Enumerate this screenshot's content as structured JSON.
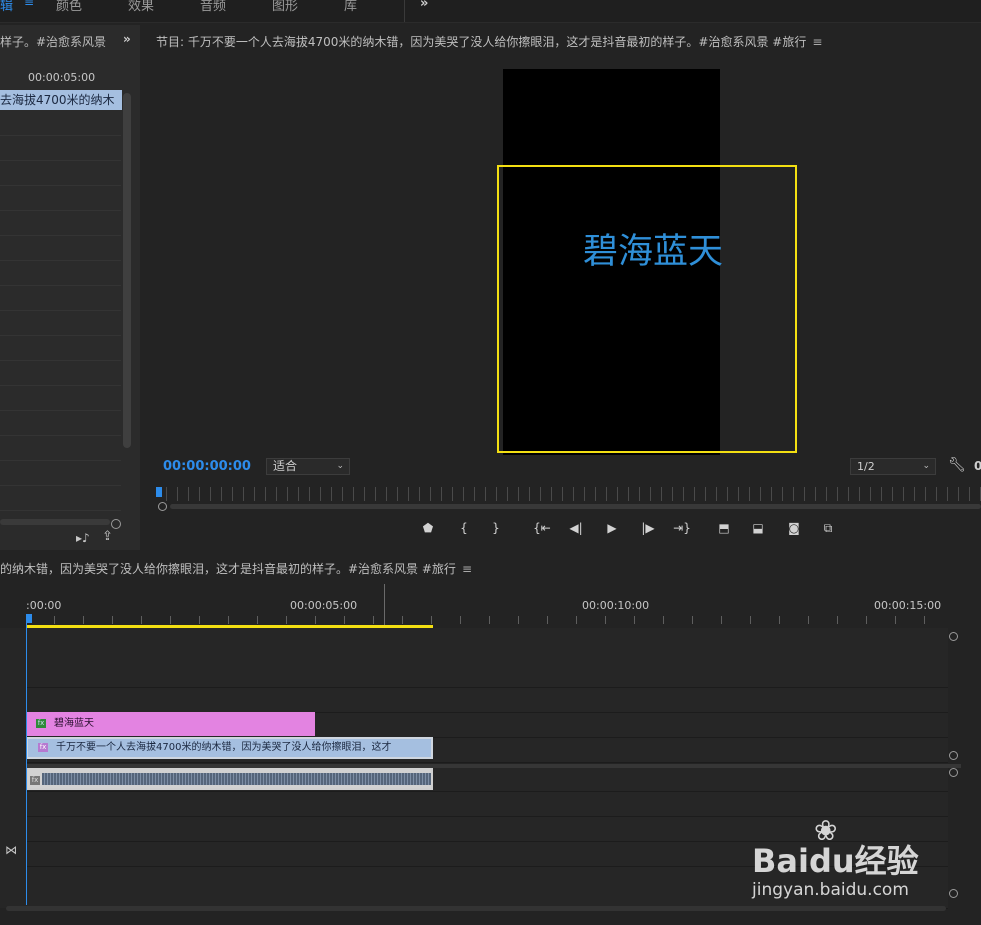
{
  "workspace_tabs": [
    {
      "label": "辑",
      "active": true
    },
    {
      "label": "颜色",
      "active": false
    },
    {
      "label": "效果",
      "active": false
    },
    {
      "label": "音频",
      "active": false
    },
    {
      "label": "图形",
      "active": false
    },
    {
      "label": "库",
      "active": false
    }
  ],
  "workspace_more": "»",
  "source": {
    "title": "样子。#治愈系风景",
    "more": "»",
    "ruler_timecode": "00:00:05:00",
    "clip_label": "去海拔4700米的纳木"
  },
  "program": {
    "title": "节目: 千万不要一个人去海拔4700米的纳木错，因为美哭了没人给你擦眼泪，这才是抖音最初的样子。#治愈系风景 #旅行",
    "menu_icon": "≡",
    "video_text": "碧海蓝天",
    "timecode": "00:00:00:00",
    "fit": "适合",
    "resolution": "1/2",
    "right_edge_text": "0",
    "transport_icons": [
      "marker-icon",
      "mark-in-icon",
      "mark-out-icon",
      "go-to-in-icon",
      "step-back-icon",
      "play-icon",
      "step-forward-icon",
      "go-to-out-icon",
      "lift-icon",
      "extract-icon",
      "export-frame-icon",
      "compare-icon"
    ]
  },
  "timeline": {
    "title": "的纳木错，因为美哭了没人给你擦眼泪，这才是抖音最初的样子。#治愈系风景 #旅行",
    "menu_icon": "≡",
    "ruler": [
      ":00:00",
      "00:00:05:00",
      "00:00:10:00",
      "00:00:15:00"
    ],
    "clips": {
      "title_clip": "碧海蓝天",
      "video_clip": "千万不要一个人去海拔4700米的纳木错，因为美哭了没人给你擦眼泪，这才",
      "audio_clip": ""
    }
  },
  "watermark": {
    "logo": "Baidu经验",
    "url": "jingyan.baidu.com"
  },
  "colors": {
    "accent": "#2d8ceb",
    "work_area": "#f3df12",
    "title_clip": "#e383e1",
    "video_clip": "#a5bfe0",
    "video_text": "#2f8fd8"
  }
}
